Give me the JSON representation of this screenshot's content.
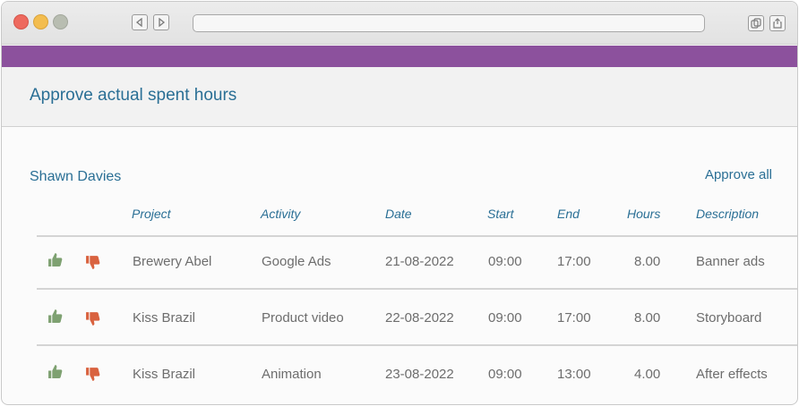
{
  "colors": {
    "accent": "#2a6f95",
    "band": "#8c519d",
    "approve": "#7ea171",
    "reject": "#d9623f"
  },
  "page": {
    "title": "Approve actual spent hours"
  },
  "section": {
    "person": "Shawn Davies",
    "approve_all": "Approve all"
  },
  "table": {
    "headers": [
      "Project",
      "Activity",
      "Date",
      "Start",
      "End",
      "Hours",
      "Description"
    ],
    "rows": [
      {
        "project": "Brewery Abel",
        "activity": "Google Ads",
        "date": "21-08-2022",
        "start": "09:00",
        "end": "17:00",
        "hours": "8.00",
        "description": "Banner ads"
      },
      {
        "project": "Kiss Brazil",
        "activity": "Product video",
        "date": "22-08-2022",
        "start": "09:00",
        "end": "17:00",
        "hours": "8.00",
        "description": "Storyboard"
      },
      {
        "project": "Kiss Brazil",
        "activity": "Animation",
        "date": "23-08-2022",
        "start": "09:00",
        "end": "13:00",
        "hours": "4.00",
        "description": "After effects"
      }
    ]
  },
  "icons": {
    "approve": "thumbs-up-icon",
    "reject": "thumbs-down-icon"
  }
}
